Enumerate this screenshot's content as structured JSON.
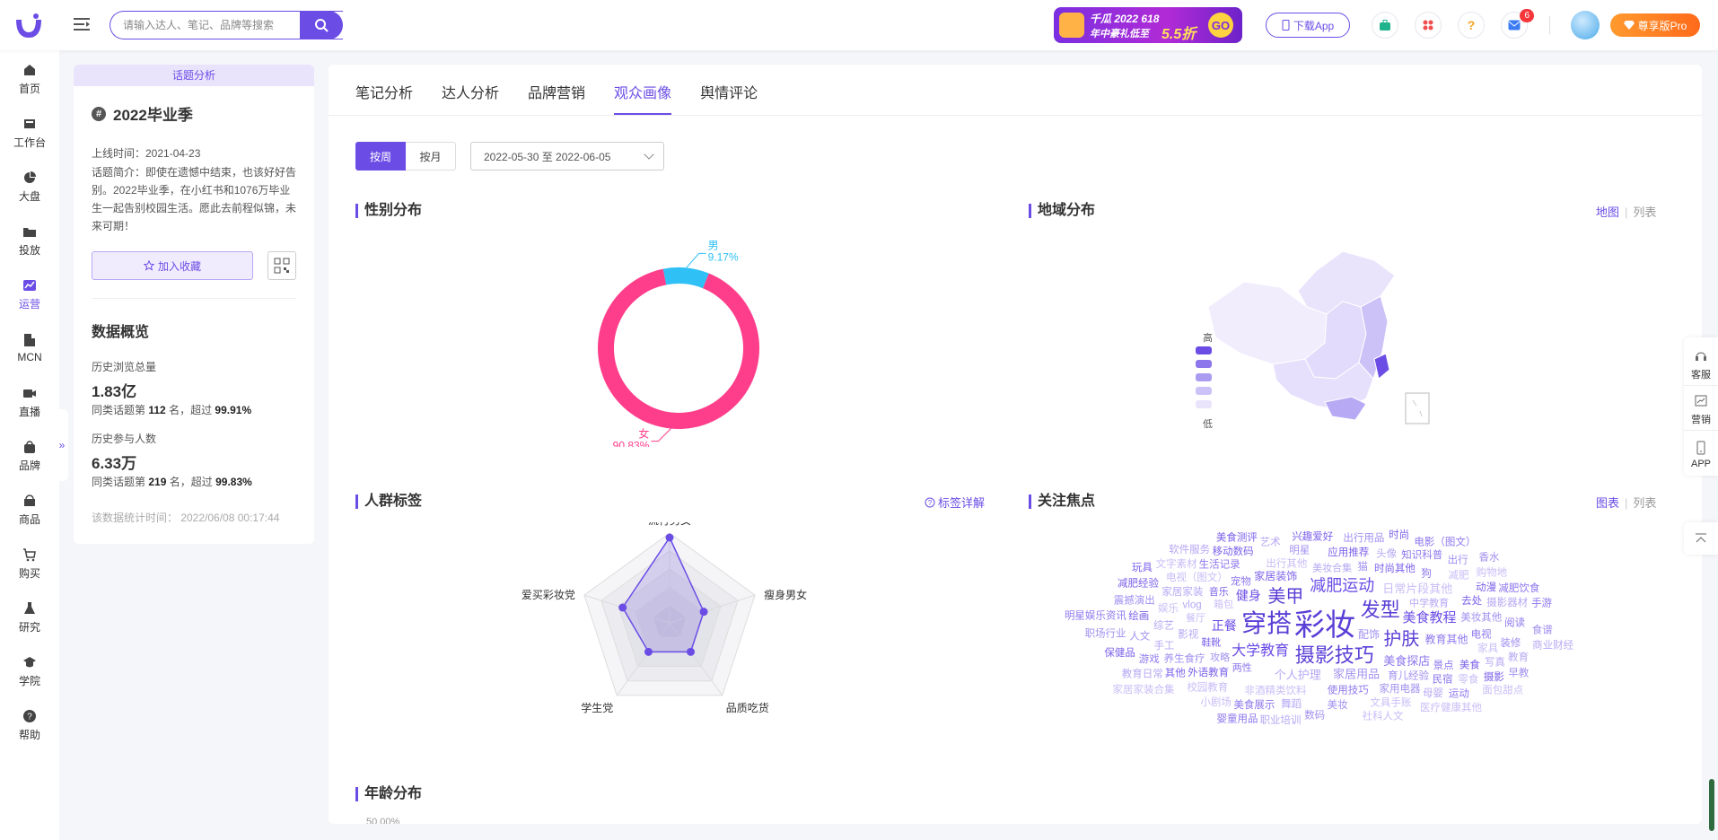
{
  "header": {
    "search_placeholder": "请输入达人、笔记、品牌等搜索",
    "banner": {
      "line1": "千瓜 2022 618",
      "line2": "年中豪礼低至",
      "discount": "5.5折",
      "go": "GO"
    },
    "download_app": "下载App",
    "message_badge": "6",
    "pro_label": "尊享版Pro"
  },
  "sidebar": {
    "items": [
      {
        "label": "首页",
        "icon": "home-icon"
      },
      {
        "label": "工作台",
        "icon": "workbench-icon"
      },
      {
        "label": "大盘",
        "icon": "pie-icon"
      },
      {
        "label": "投放",
        "icon": "folder-icon"
      },
      {
        "label": "运营",
        "icon": "trend-icon"
      },
      {
        "label": "MCN",
        "icon": "building-icon"
      },
      {
        "label": "直播",
        "icon": "video-icon"
      },
      {
        "label": "品牌",
        "icon": "bag-icon"
      },
      {
        "label": "商品",
        "icon": "shop-icon"
      },
      {
        "label": "购买",
        "icon": "cart-icon"
      },
      {
        "label": "研究",
        "icon": "flask-icon"
      },
      {
        "label": "学院",
        "icon": "cap-icon"
      },
      {
        "label": "帮助",
        "icon": "help-icon"
      }
    ],
    "active": "运营",
    "expand_glyph": "»"
  },
  "topic": {
    "tag": "话题分析",
    "title": "2022毕业季",
    "online": "上线时间：2021-04-23",
    "intro": "话题简介：即使在遗憾中结束，也该好好告别。2022毕业季，在小红书和1076万毕业生一起告别校园生活。愿此去前程似锦，未来可期！",
    "fav_label": "加入收藏",
    "overview_title": "数据概览",
    "stats": [
      {
        "label": "历史浏览总量",
        "value": "1.83亿",
        "rank_pre": "同类话题第",
        "rank": "112",
        "rank_mid": "名，超过",
        "pct": "99.91%"
      },
      {
        "label": "历史参与人数",
        "value": "6.33万",
        "rank_pre": "同类话题第",
        "rank": "219",
        "rank_mid": "名，超过",
        "pct": "99.83%"
      }
    ],
    "stat_time": "该数据统计时间：  2022/06/08 00:17:44"
  },
  "main": {
    "tabs": [
      "笔记分析",
      "达人分析",
      "品牌营销",
      "观众画像",
      "舆情评论"
    ],
    "active_tab": "观众画像",
    "seg": [
      "按周",
      "按月"
    ],
    "date_range": "2022-05-30 至 2022-06-05",
    "gender_title": "性别分布",
    "region_title": "地域分布",
    "region_links": {
      "a": "地图",
      "b": "列表"
    },
    "region_legend": {
      "high": "高",
      "low": "低"
    },
    "crowd_title": "人群标签",
    "crowd_link": "标签详解",
    "focus_title": "关注焦点",
    "focus_links": {
      "a": "图表",
      "b": "列表"
    },
    "age_title": "年龄分布",
    "age_partial": "50.00%"
  },
  "right_tools": [
    {
      "label": "客服",
      "icon": "headset-icon"
    },
    {
      "label": "营销",
      "icon": "chart-icon"
    },
    {
      "label": "APP",
      "icon": "phone-icon"
    }
  ],
  "colors": {
    "accent": "#6b4de6",
    "female": "#ff3e8b",
    "male": "#2fc0f5"
  },
  "chart_data": [
    {
      "type": "pie",
      "categories": [
        "女",
        "男"
      ],
      "values": [
        90.83,
        9.17
      ],
      "labels": [
        "90.83%",
        "9.17%"
      ]
    },
    {
      "type": "radar",
      "categories": [
        "流行男女",
        "瘦身男女",
        "品质吃货",
        "学生党",
        "爱买彩妆党"
      ],
      "values": [
        95,
        40,
        40,
        40,
        55
      ],
      "ylim": [
        0,
        100
      ]
    },
    {
      "type": "wordcloud",
      "words": [
        [
          "彩妆",
          36
        ],
        [
          "穿搭",
          28
        ],
        [
          "摄影技巧",
          22
        ],
        [
          "发型",
          22
        ],
        [
          "美甲",
          20
        ],
        [
          "护肤",
          20
        ],
        [
          "减肥运动",
          18
        ],
        [
          "大学教育",
          16
        ],
        [
          "美食教程",
          15
        ],
        [
          "正餐",
          14
        ],
        [
          "健身",
          14
        ],
        [
          "美食探店",
          13
        ],
        [
          "家居用品",
          13
        ],
        [
          "个人护理",
          13
        ],
        [
          "日常片段其他",
          13
        ],
        [
          "家居装饰",
          12
        ],
        [
          "教育其他",
          12
        ],
        [
          "配饰",
          12
        ],
        [
          "中学教育",
          11
        ],
        [
          "箱包",
          11
        ],
        [
          "鞋靴",
          11
        ],
        [
          "两性",
          11
        ],
        [
          "攻略",
          11
        ],
        [
          "美妆合集",
          11
        ],
        [
          "餐厅",
          11
        ],
        [
          "音乐",
          11
        ],
        [
          "宠物",
          10
        ],
        [
          "育儿经验",
          10
        ],
        [
          "影视",
          10
        ],
        [
          "出行其他",
          10
        ],
        [
          "时尚其他",
          10
        ],
        [
          "使用技巧",
          10
        ],
        [
          "美妆其他",
          10
        ],
        [
          "vlog",
          10
        ],
        [
          "非酒精类饮料",
          10
        ],
        [
          "外语教育",
          10
        ],
        [
          "景点",
          10
        ],
        [
          "养生食疗",
          10
        ],
        [
          "家居家装",
          10
        ],
        [
          "电视（图文）",
          10
        ],
        [
          "去处",
          10
        ],
        [
          "电视",
          10
        ],
        [
          "家用电器",
          10
        ],
        [
          "综艺",
          10
        ],
        [
          "娱乐",
          10
        ],
        [
          "应用推荐",
          10
        ],
        [
          "生活记录",
          10
        ],
        [
          "猫",
          10
        ],
        [
          "手工",
          10
        ],
        [
          "家具",
          10
        ],
        [
          "美食",
          10
        ],
        [
          "民宿",
          10
        ],
        [
          "明星",
          10
        ],
        [
          "头像",
          10
        ],
        [
          "减肥",
          10
        ],
        [
          "动漫",
          10
        ],
        [
          "狗",
          10
        ],
        [
          "美妆",
          10
        ],
        [
          "舞蹈",
          10
        ],
        [
          "校园教育",
          10
        ],
        [
          "其他",
          10
        ],
        [
          "知识科普",
          10
        ],
        [
          "人文",
          10
        ],
        [
          "摄影器材",
          10
        ],
        [
          "文具手账",
          10
        ],
        [
          "绘画",
          10
        ],
        [
          "阅读",
          10
        ],
        [
          "装修",
          10
        ],
        [
          "写真",
          10
        ],
        [
          "零食",
          10
        ],
        [
          "移动数码",
          10
        ],
        [
          "美食展示",
          10
        ],
        [
          "震撼演出",
          10
        ],
        [
          "母婴",
          10
        ],
        [
          "文字素材",
          10
        ],
        [
          "兴趣爱好",
          10
        ],
        [
          "游戏",
          10
        ],
        [
          "出行用品",
          10
        ],
        [
          "艺术",
          10
        ],
        [
          "购物地",
          10
        ],
        [
          "减肥经验",
          10
        ],
        [
          "减肥饮食",
          10
        ],
        [
          "出行",
          10
        ],
        [
          "教育",
          10
        ],
        [
          "小剧场",
          10
        ],
        [
          "摄影",
          10
        ],
        [
          "运动",
          10
        ],
        [
          "数码",
          10
        ],
        [
          "教育日常",
          10
        ],
        [
          "社科人文",
          10
        ],
        [
          "保健品",
          10
        ],
        [
          "电影（图文）",
          10
        ],
        [
          "职场行业",
          10
        ],
        [
          "软件服务",
          10
        ],
        [
          "医疗健康其他",
          10
        ],
        [
          "美食测评",
          10
        ],
        [
          "明星娱乐资讯",
          10
        ],
        [
          "食谱",
          10
        ],
        [
          "职业培训",
          10
        ],
        [
          "家居家装合集",
          10
        ],
        [
          "时尚",
          10
        ],
        [
          "手游",
          10
        ],
        [
          "早教",
          10
        ],
        [
          "商业财经",
          10
        ],
        [
          "面包甜点",
          10
        ],
        [
          "玩具",
          10
        ],
        [
          "婴童用品",
          10
        ],
        [
          "香水",
          10
        ]
      ]
    }
  ]
}
